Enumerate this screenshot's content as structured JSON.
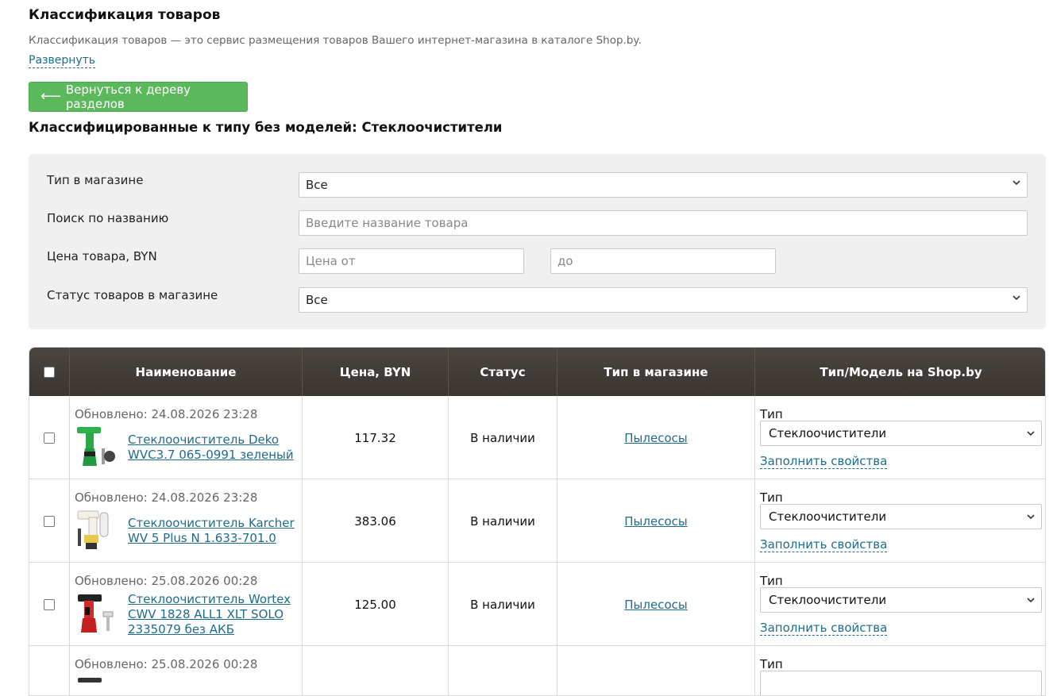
{
  "header": {
    "title": "Классификация товаров",
    "description": "Классификация товаров — это сервис размещения товаров Вашего интернет-магазина в каталоге Shop.by.",
    "expand_label": "Развернуть",
    "back_button": "Вернуться к дереву разделов",
    "subtitle": "Классифицированные к типу без моделей: Стеклоочистители"
  },
  "filter": {
    "type_label": "Тип в магазине",
    "type_value": "Все",
    "search_label": "Поиск по названию",
    "search_placeholder": "Введите название товара",
    "price_label": "Цена товара, BYN",
    "price_from_placeholder": "Цена от",
    "price_to_placeholder": "до",
    "status_label": "Статус товаров в магазине",
    "status_value": "Все"
  },
  "table": {
    "columns": [
      "Наименование",
      "Цена, BYN",
      "Статус",
      "Тип в магазине",
      "Тип/Модель на Shop.by"
    ],
    "rows": [
      {
        "updated": "Обновлено: 24.08.2026 23:28",
        "name": "Стеклоочиститель Deko WVC3.7 065-0991 зеленый",
        "price": "117.32",
        "status": "В наличии",
        "shop_type": "Пылесосы",
        "type_label": "Тип",
        "type_value": "Стеклоочистители",
        "fill_link": "Заполнить свойства",
        "image_icon": "green-window-vacuum"
      },
      {
        "updated": "Обновлено: 24.08.2026 23:28",
        "name": "Стеклоочиститель Karcher WV 5 Plus N 1.633-701.0",
        "price": "383.06",
        "status": "В наличии",
        "shop_type": "Пылесосы",
        "type_label": "Тип",
        "type_value": "Стеклоочистители",
        "fill_link": "Заполнить свойства",
        "image_icon": "white-window-vacuum"
      },
      {
        "updated": "Обновлено: 25.08.2026 00:28",
        "name": "Стеклоочиститель Wortex CWV 1828 ALL1 XLT SOLO 2335079 без АКБ",
        "price": "125.00",
        "status": "В наличии",
        "shop_type": "Пылесосы",
        "type_label": "Тип",
        "type_value": "Стеклоочистители",
        "fill_link": "Заполнить свойства",
        "image_icon": "red-window-vacuum"
      },
      {
        "updated": "Обновлено: 25.08.2026 00:28",
        "type_label": "Тип"
      }
    ]
  },
  "colors": {
    "back_button": "#5cb85c",
    "table_header": "#3f3a35",
    "link": "#1f6b8c",
    "filter_bg": "#f0f0f0"
  }
}
